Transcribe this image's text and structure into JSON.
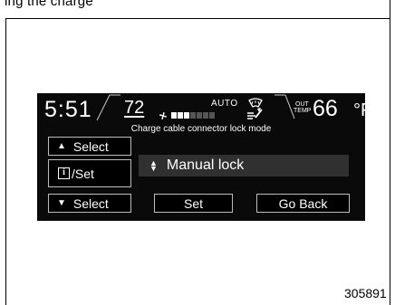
{
  "page_top_text": "ing the charge",
  "display": {
    "clock": "5:51",
    "set_temp": "72",
    "auto_label": "AUTO",
    "fan_level": 3,
    "fan_total": 7,
    "out_label_line1": "OUT",
    "out_label_line2": "TEMP",
    "out_temp": "66",
    "out_unit": "°F",
    "mode_title": "Charge cable connector lock mode",
    "buttons": {
      "select_up": "Select",
      "info_set": "/Set",
      "info_icon": "i",
      "select_down": "Select",
      "set": "Set",
      "go_back": "Go Back"
    },
    "option_value": "Manual lock"
  },
  "figure_number": "305891",
  "colors": {
    "screen_bg": "#0a0a0a",
    "option_bg": "#303030",
    "fan_on": "#ffffff",
    "fan_off": "#555555"
  }
}
